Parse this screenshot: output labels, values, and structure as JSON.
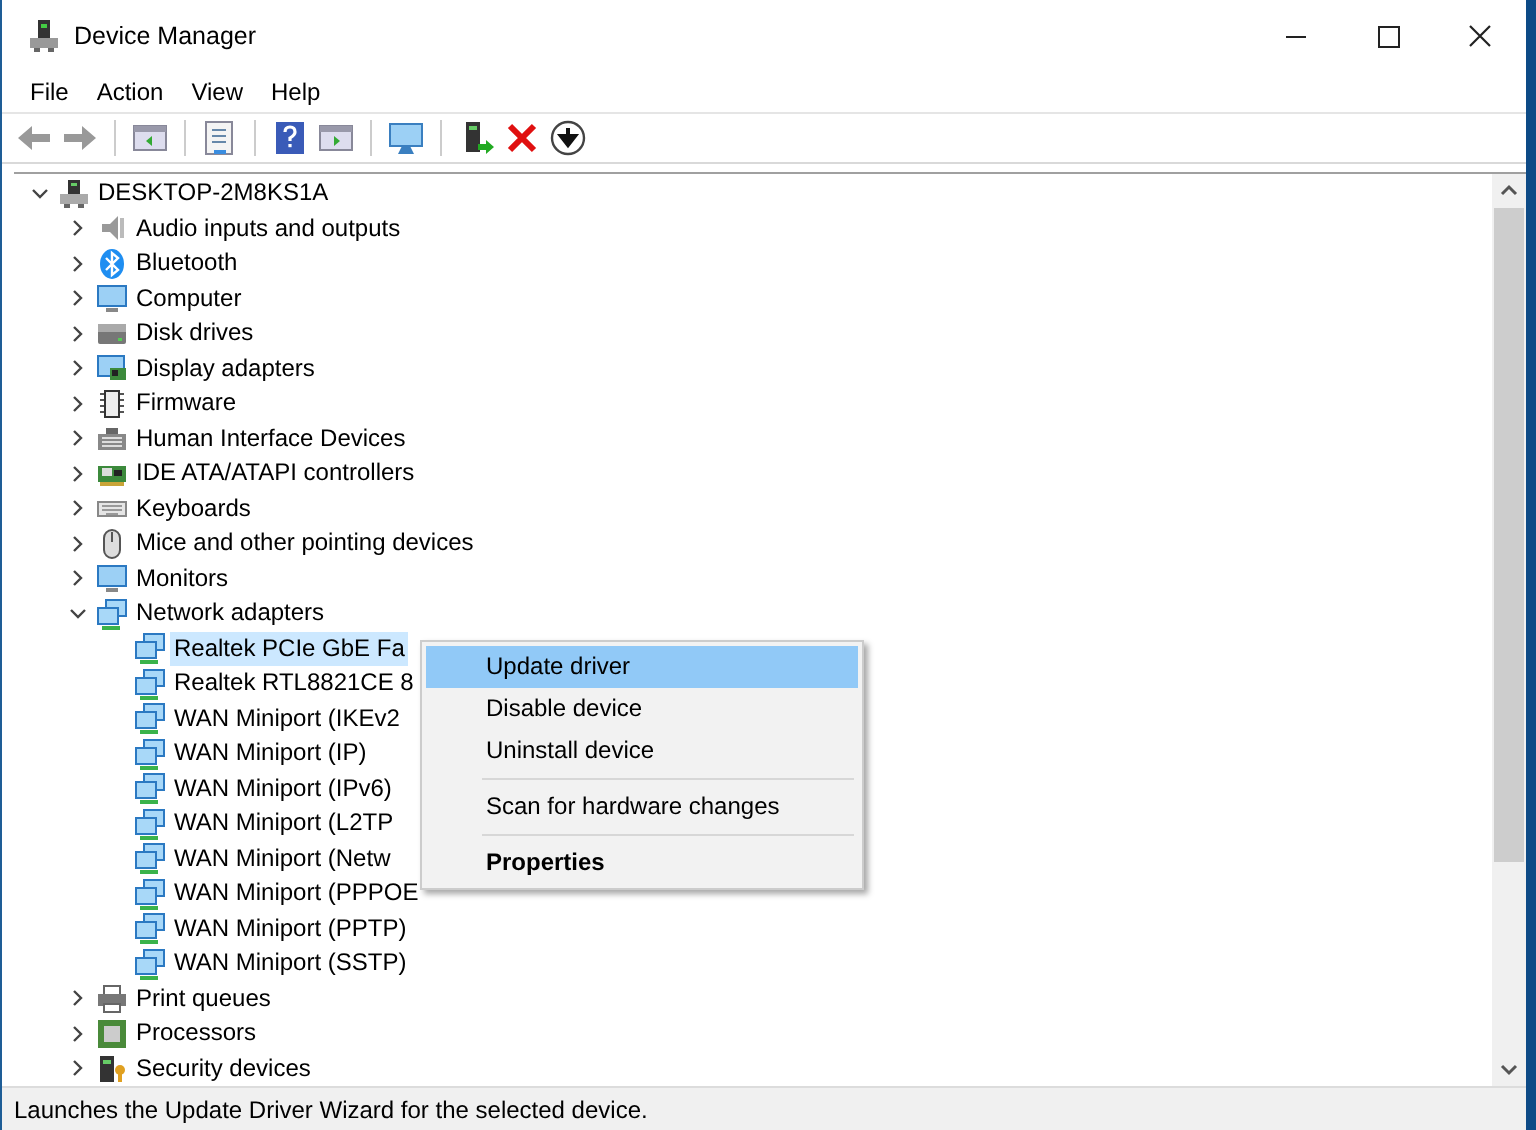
{
  "window": {
    "title": "Device Manager"
  },
  "menu_bar": [
    "File",
    "Action",
    "View",
    "Help"
  ],
  "tree": {
    "label": "DESKTOP-2M8KS1A",
    "expanded": true,
    "selected": false,
    "children": [
      {
        "label": "Audio inputs and outputs",
        "expanded": false,
        "selected": false
      },
      {
        "label": "Bluetooth",
        "expanded": false,
        "selected": false
      },
      {
        "label": "Computer",
        "expanded": false,
        "selected": false
      },
      {
        "label": "Disk drives",
        "expanded": false,
        "selected": false
      },
      {
        "label": "Display adapters",
        "expanded": false,
        "selected": false
      },
      {
        "label": "Firmware",
        "expanded": false,
        "selected": false
      },
      {
        "label": "Human Interface Devices",
        "expanded": false,
        "selected": false
      },
      {
        "label": "IDE ATA/ATAPI controllers",
        "expanded": false,
        "selected": false
      },
      {
        "label": "Keyboards",
        "expanded": false,
        "selected": false
      },
      {
        "label": "Mice and other pointing devices",
        "expanded": false,
        "selected": false
      },
      {
        "label": "Monitors",
        "expanded": false,
        "selected": false
      },
      {
        "label": "Network adapters",
        "expanded": true,
        "selected": false,
        "children": [
          {
            "label": "Realtek PCIe GbE Fa",
            "selected": true
          },
          {
            "label": "Realtek RTL8821CE 8",
            "selected": false
          },
          {
            "label": "WAN Miniport (IKEv2",
            "selected": false
          },
          {
            "label": "WAN Miniport (IP)",
            "selected": false
          },
          {
            "label": "WAN Miniport (IPv6)",
            "selected": false
          },
          {
            "label": "WAN Miniport (L2TP",
            "selected": false
          },
          {
            "label": "WAN Miniport (Netw",
            "selected": false
          },
          {
            "label": "WAN Miniport (PPPOE",
            "selected": false
          },
          {
            "label": "WAN Miniport (PPTP)",
            "selected": false
          },
          {
            "label": "WAN Miniport (SSTP)",
            "selected": false
          }
        ]
      },
      {
        "label": "Print queues",
        "expanded": false,
        "selected": false
      },
      {
        "label": "Processors",
        "expanded": false,
        "selected": false
      },
      {
        "label": "Security devices",
        "expanded": false,
        "selected": false
      }
    ]
  },
  "context_menu": [
    {
      "kind": "item",
      "label": "Update driver",
      "selected": true,
      "default": false
    },
    {
      "kind": "item",
      "label": "Disable device",
      "selected": false,
      "default": false
    },
    {
      "kind": "item",
      "label": "Uninstall device",
      "selected": false,
      "default": false
    },
    {
      "kind": "separator"
    },
    {
      "kind": "item",
      "label": "Scan for hardware changes",
      "selected": false,
      "default": false
    },
    {
      "kind": "separator"
    },
    {
      "kind": "item",
      "label": "Properties",
      "selected": false,
      "default": true
    }
  ],
  "status_bar": "Launches the Update Driver Wizard for the selected device."
}
